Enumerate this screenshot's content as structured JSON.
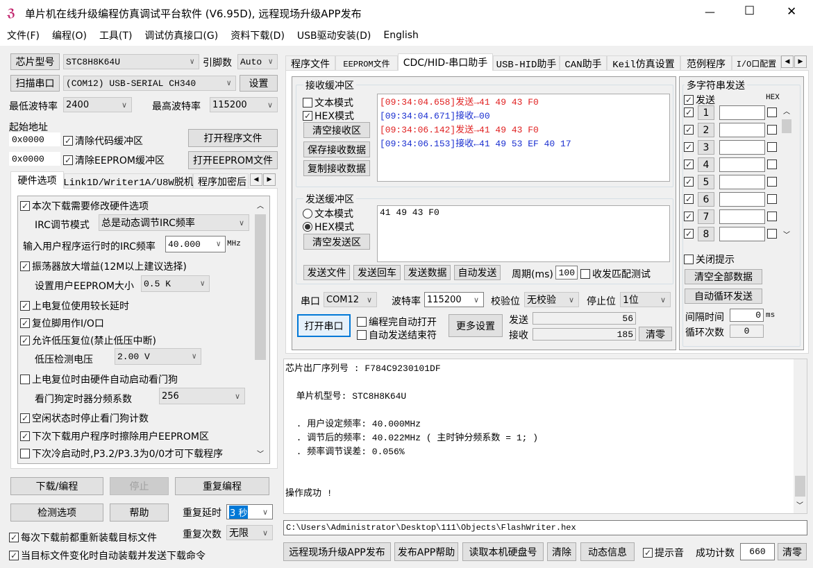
{
  "title": "单片机在线升级编程仿真调试平台软件 (V6.95D), 远程现场升级APP发布",
  "window_controls": {
    "minimize": "—",
    "maximize": "☐",
    "close": "✕"
  },
  "menu": [
    "文件(F)",
    "编程(O)",
    "工具(T)",
    "调试仿真接口(G)",
    "资料下载(D)",
    "USB驱动安装(D)",
    "English"
  ],
  "left": {
    "chip_btn": "芯片型号",
    "chip": "STC8H8K64U",
    "pin_label": "引脚数",
    "pin": "Auto",
    "scan_btn": "扫描串口",
    "port": "(COM12) USB-SERIAL CH340",
    "settings_btn": "设置",
    "min_baud_label": "最低波特率",
    "min_baud": "2400",
    "max_baud_label": "最高波特率",
    "max_baud": "115200",
    "start_addr_label": "起始地址",
    "addr1": "0x0000",
    "addr2": "0x0000",
    "clear_code": "清除代码缓冲区",
    "clear_eeprom": "清除EEPROM缓冲区",
    "open_prog": "打开程序文件",
    "open_eeprom": "打开EEPROM文件",
    "tabs": [
      "硬件选项",
      "Link1D/Writer1A/U8W脱机",
      "程序加密后"
    ],
    "options": {
      "o1": "本次下载需要修改硬件选项",
      "irc_mode_label": "IRC调节模式",
      "irc_mode": "总是动态调节IRC频率",
      "irc_freq_label": "输入用户程序运行时的IRC频率",
      "irc_freq": "40.000",
      "mhz": "MHz",
      "o2": "振荡器放大增益(12M以上建议选择)",
      "eeprom_label": "设置用户EEPROM大小",
      "eeprom": "0.5 K",
      "o3": "上电复位使用较长延时",
      "o4": "复位脚用作I/O口",
      "o5": "允许低压复位(禁止低压中断)",
      "lv_label": "低压检测电压",
      "lv": "2.00 V",
      "o6": "上电复位时由硬件自动启动看门狗",
      "wdt_label": "看门狗定时器分频系数",
      "wdt": "256",
      "o7": "空闲状态时停止看门狗计数",
      "o8": "下次下载用户程序时擦除用户EEPROM区",
      "o9": "下次冷启动时,P3.2/P3.3为0/0才可下载程序"
    },
    "download": "下载/编程",
    "stop": "停止",
    "repeat": "重复编程",
    "check": "检测选项",
    "help": "帮助",
    "repeat_delay_label": "重复延时",
    "repeat_delay": "3 秒",
    "repeat_count_label": "重复次数",
    "repeat_count": "无限",
    "reload": "每次下载前都重新装载目标文件",
    "auto_load": "当目标文件变化时自动装载并发送下载命令"
  },
  "right": {
    "tabs": [
      "程序文件",
      "EEPROM文件",
      "CDC/HID-串口助手",
      "USB-HID助手",
      "CAN助手",
      "Keil仿真设置",
      "范例程序",
      "I/O口配置"
    ],
    "recv": {
      "legend": "接收缓冲区",
      "text_mode": "文本模式",
      "hex_mode": "HEX模式",
      "clear": "清空接收区",
      "save": "保存接收数据",
      "copy": "复制接收数据",
      "lines": [
        {
          "t": "[09:34:04.658]发送→41 49 43 F0",
          "c": "#e02020"
        },
        {
          "t": "[09:34:04.671]接收←00",
          "c": "#1a2fd0"
        },
        {
          "t": "[09:34:06.142]发送→41 49 43 F0",
          "c": "#e02020"
        },
        {
          "t": "[09:34:06.153]接收←41 49 53 EF 40 17",
          "c": "#1a2fd0"
        }
      ]
    },
    "send": {
      "legend": "发送缓冲区",
      "text_mode": "文本模式",
      "hex_mode": "HEX模式",
      "clear": "清空发送区",
      "content": "41 49 43 F0",
      "send_file": "发送文件",
      "send_cr": "发送回车",
      "send_data": "发送数据",
      "auto_send": "自动发送",
      "period_label": "周期(ms)",
      "period": "100",
      "match_test": "收发匹配测试"
    },
    "port_label": "串口",
    "port": "COM12",
    "baud_label": "波特率",
    "baud": "115200",
    "parity_label": "校验位",
    "parity": "无校验",
    "stop_label": "停止位",
    "stop": "1位",
    "open_port": "打开串口",
    "auto_open": "编程完自动打开",
    "auto_end": "自动发送结束符",
    "more": "更多设置",
    "sent_label": "发送",
    "sent": "56",
    "recv_label": "接收",
    "recvd": "185",
    "zero": "清零",
    "multi": {
      "legend": "多字符串发送",
      "send": "发送",
      "hex": "HEX",
      "rows": [
        "1",
        "2",
        "3",
        "4",
        "5",
        "6",
        "7",
        "8"
      ],
      "close_tip": "关闭提示",
      "clear_all": "清空全部数据",
      "auto_loop": "自动循环发送",
      "interval_label": "间隔时间",
      "interval": "0",
      "ms": "ms",
      "loop_label": "循环次数",
      "loop": "0"
    }
  },
  "log": [
    "芯片出厂序列号 : F784C9230101DF",
    "",
    "  单片机型号: STC8H8K64U",
    "",
    "  . 用户设定频率: 40.000MHz",
    "  . 调节后的频率: 40.022MHz ( 主时钟分频系数 = 1; )",
    "  . 频率调节误差: 0.056%",
    "",
    "",
    "操作成功 !"
  ],
  "file_path": "C:\\Users\\Administrator\\Desktop\\111\\Objects\\FlashWriter.hex",
  "bottom": {
    "publish": "远程现场升级APP发布",
    "publish_help": "发布APP帮助",
    "read_disk": "读取本机硬盘号",
    "clear": "清除",
    "dyn": "动态信息",
    "sound": "提示音",
    "count_label": "成功计数",
    "count": "660",
    "zero": "清零"
  }
}
